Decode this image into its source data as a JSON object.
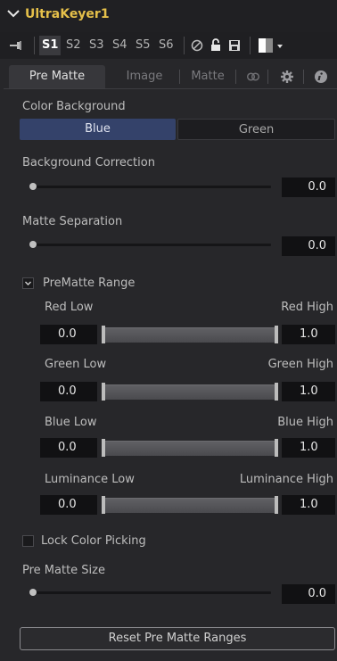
{
  "node": {
    "title": "UltraKeyer1"
  },
  "toolbar": {
    "slots": [
      "S1",
      "S2",
      "S3",
      "S4",
      "S5",
      "S6"
    ]
  },
  "tabs": {
    "pre_matte": "Pre Matte",
    "image": "Image",
    "matte": "Matte"
  },
  "color_background": {
    "label": "Color Background",
    "options": [
      "Blue",
      "Green"
    ],
    "selected": "Blue"
  },
  "background_correction": {
    "label": "Background Correction",
    "value": "0.0"
  },
  "matte_separation": {
    "label": "Matte Separation",
    "value": "0.0"
  },
  "prematte_range": {
    "label": "PreMatte Range",
    "expanded": true,
    "red": {
      "low_label": "Red Low",
      "high_label": "Red High",
      "low": "0.0",
      "high": "1.0"
    },
    "green": {
      "low_label": "Green Low",
      "high_label": "Green High",
      "low": "0.0",
      "high": "1.0"
    },
    "blue": {
      "low_label": "Blue Low",
      "high_label": "Blue High",
      "low": "0.0",
      "high": "1.0"
    },
    "luminance": {
      "low_label": "Luminance Low",
      "high_label": "Luminance High",
      "low": "0.0",
      "high": "1.0"
    }
  },
  "lock_color_picking": {
    "label": "Lock Color Picking",
    "checked": false
  },
  "pre_matte_size": {
    "label": "Pre Matte Size",
    "value": "0.0"
  },
  "reset_button": {
    "label": "Reset Pre Matte Ranges"
  },
  "colors": {
    "accent": "#e5c04a",
    "selected_segment": "#34426a"
  }
}
